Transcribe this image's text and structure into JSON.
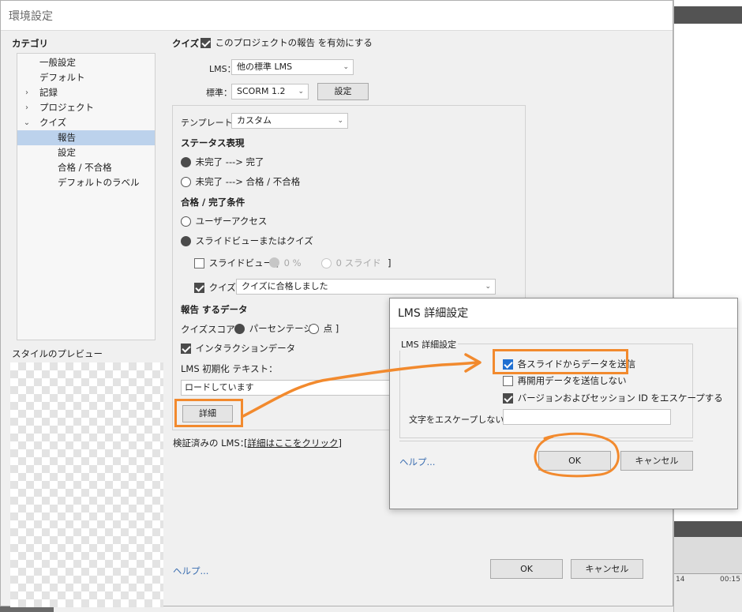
{
  "window": {
    "title": "環境設定"
  },
  "sidebar": {
    "category_label": "カテゴリ",
    "items": [
      {
        "label": "一般設定",
        "level": 0,
        "chevron": ""
      },
      {
        "label": "デフォルト",
        "level": 0,
        "chevron": ""
      },
      {
        "label": "記録",
        "level": 0,
        "chevron": "›"
      },
      {
        "label": "プロジェクト",
        "level": 0,
        "chevron": "›"
      },
      {
        "label": "クイズ",
        "level": 0,
        "chevron": "⌄"
      },
      {
        "label": "報告",
        "level": 1,
        "chevron": "",
        "selected": true
      },
      {
        "label": "設定",
        "level": 1,
        "chevron": ""
      },
      {
        "label": "合格 / 不合格",
        "level": 1,
        "chevron": ""
      },
      {
        "label": "デフォルトのラベル",
        "level": 1,
        "chevron": ""
      }
    ],
    "preview_label": "スタイルのプレビュー"
  },
  "quiz": {
    "prefix": "クイズ：",
    "enable_label": "このプロジェクトの報告 を有効にする",
    "lms_label": "LMS：",
    "lms_value": "他の標準 LMS",
    "standard_label": "標準：",
    "standard_value": "SCORM 1.2",
    "settings_button": "設定"
  },
  "panel": {
    "template_label": "テンプレート：",
    "template_value": "カスタム",
    "status_heading": "ステータス表現",
    "status_opt1": "未完了 ---> 完了",
    "status_opt2": "未完了 ---> 合格 / 不合格",
    "cond_heading": "合格 / 完了条件",
    "cond_opt1": "ユーザーアクセス",
    "cond_opt2": "スライドビューまたはクイズ",
    "slideview_label": "スライドビュー [",
    "slideview_pct": "0 %",
    "slideview_slides": "0 スライド",
    "slideview_close": "]",
    "quiz_label": "クイズ",
    "quiz_value": "クイズに合格しました",
    "report_heading": "報告 するデータ",
    "score_label": "クイズスコア [",
    "score_pct": "パーセンテージ",
    "score_pts": "点 ]",
    "interaction_label": "インタラクションデータ",
    "init_label": "LMS 初期化 テキスト：",
    "init_value": "ロードしています",
    "details_button": "詳細"
  },
  "footer": {
    "verified_label": "検証済みの LMS：",
    "verified_link": "[詳細はここをクリック]",
    "help": "ヘルプ...",
    "ok": "OK",
    "cancel": "キャンセル"
  },
  "lms_dialog": {
    "title": "LMS 詳細設定",
    "group_label": "LMS 詳細設定",
    "opt_send": "各スライドからデータを送信",
    "opt_resume": "再開用データを送信しない",
    "opt_escape": "バージョンおよびセッション ID をエスケープする",
    "noescape_label": "文字をエスケープしない：",
    "noescape_value": "",
    "help": "ヘルプ...",
    "ok": "OK",
    "cancel": "キャンセル"
  },
  "background_app": {
    "ruler_a": "14",
    "ruler_b": "00:15"
  },
  "colors": {
    "annotation": "#f28a2e",
    "selection": "#bcd2ec",
    "checkbox_blue": "#1f6fd1"
  }
}
